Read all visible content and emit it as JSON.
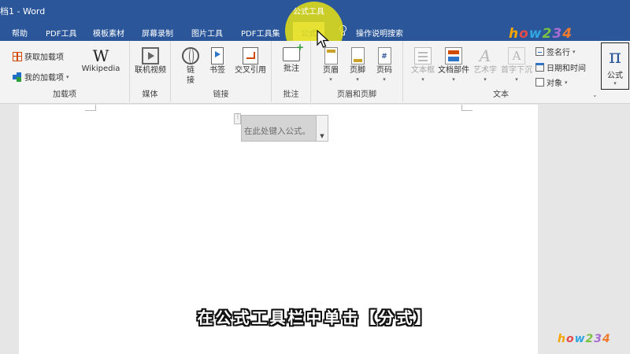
{
  "window": {
    "doc_title": "档1 - Word",
    "context_tab_title": "公式工具"
  },
  "tabs": [
    {
      "label": "帮助"
    },
    {
      "label": "PDF工具"
    },
    {
      "label": "模板素材"
    },
    {
      "label": "屏幕录制"
    },
    {
      "label": "图片工具"
    },
    {
      "label": "PDF工具集"
    },
    {
      "label": "公式",
      "active": true
    },
    {
      "label": "操作说明搜索"
    }
  ],
  "ribbon": {
    "addins": {
      "get_addins": "获取加载项",
      "my_addins": "我的加载项",
      "wikipedia_logo": "W",
      "wikipedia": "Wikipedia",
      "group_label": "加载项"
    },
    "media": {
      "online_video": "联机视频",
      "group_label": "媒体"
    },
    "links": {
      "link_line1": "链",
      "link_line2": "接",
      "bookmark": "书签",
      "cross_reference": "交叉引用",
      "group_label": "链接"
    },
    "comments": {
      "comment": "批注",
      "group_label": "批注"
    },
    "header_footer": {
      "header": "页眉",
      "footer": "页脚",
      "page_number": "页码",
      "page_number_icon": "#",
      "group_label": "页眉和页脚"
    },
    "text": {
      "text_box": "文本框",
      "quick_parts": "文档部件",
      "wordart": "艺术字",
      "wordart_icon": "A",
      "drop_cap": "首字下沉",
      "drop_cap_icon": "A",
      "signature_line": "签名行",
      "date_time": "日期和时间",
      "object": "对象",
      "group_label": "文本"
    },
    "equation": {
      "pi_symbol": "π",
      "label": "公式"
    }
  },
  "document": {
    "equation_placeholder": "在此处键入公式。"
  },
  "subtitle": "在公式工具栏中单击【分式】",
  "watermark": {
    "chars": [
      "h",
      "o",
      "w",
      "2",
      "3",
      "4"
    ]
  },
  "colors": {
    "title_bar": "#2b579a",
    "highlight": "#e6e114",
    "ribbon_bg": "#f3f3f3"
  }
}
